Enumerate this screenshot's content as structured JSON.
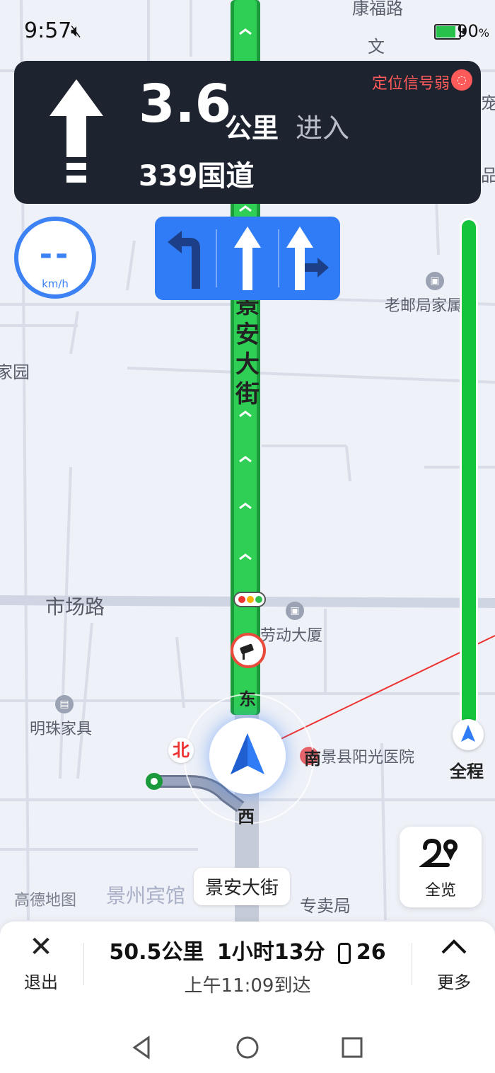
{
  "status_bar": {
    "time": "9:57",
    "battery_text": "90",
    "battery_pct_sign": "%",
    "battery_level": 0.9
  },
  "guidance": {
    "distance": "3.6",
    "unit": "公里",
    "action": "进入",
    "road_name": "339国道",
    "gps_warning": "定位信号弱"
  },
  "speed": {
    "value": "--",
    "unit": "km/h"
  },
  "lanes": [
    "left-turn",
    "straight",
    "straight-or-right"
  ],
  "map": {
    "labels": {
      "road_main_vertical": "景安大街",
      "road_market": "市场路",
      "poi_labor_building": "劳动大厦",
      "poi_laoyoju": "老邮局家属院",
      "poi_mingzhu": "明珠家具",
      "poi_hospital": "景县阳光医院",
      "top_text_1": "康福路",
      "top_text_2": "文",
      "left_text_1": "家园",
      "edge_text_1": "宠",
      "edge_text_2": "品",
      "bottom_hotel": "景州宾馆",
      "bottom_shop": "专卖局"
    },
    "compass": {
      "north": "北",
      "east": "东",
      "south": "南",
      "west": "西"
    },
    "current_road": "景安大街",
    "watermark": "高德地图"
  },
  "progress": {
    "label": "全程",
    "fraction_remaining": 1.0
  },
  "overview_button": {
    "label": "全览"
  },
  "bottom": {
    "exit_label": "退出",
    "distance_left": "50.5公里",
    "time_left": "1小时13分",
    "traffic_lights": "26",
    "eta": "上午11:09到达",
    "more_label": "更多"
  },
  "colors": {
    "route_green": "#15c43a",
    "accent_blue": "#2f7cf6",
    "card_dark": "#1e2330",
    "warning_red": "#ff5a5a"
  }
}
